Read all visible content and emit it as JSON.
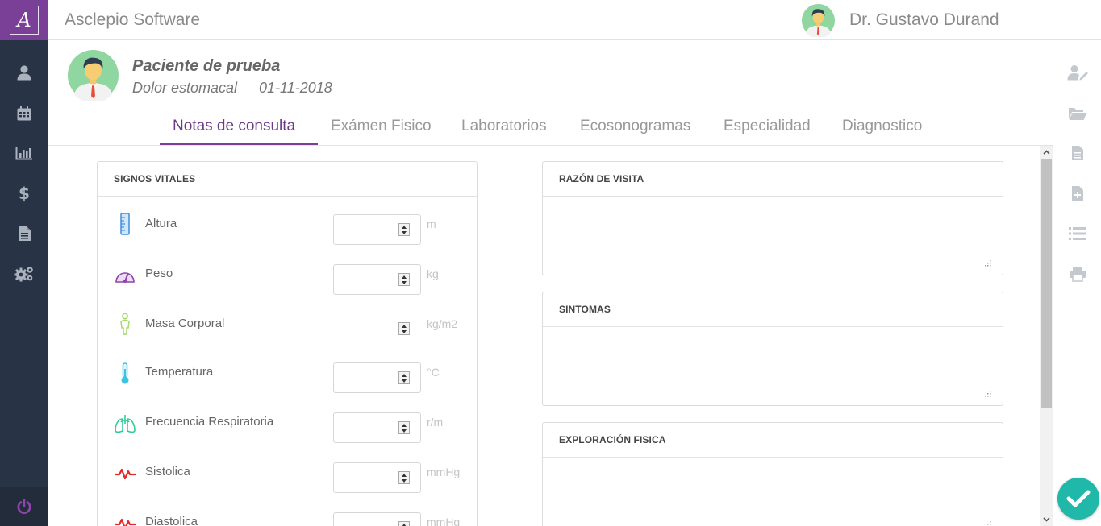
{
  "app": {
    "title": "Asclepio Software",
    "logo_letter": "A"
  },
  "user": {
    "name": "Dr. Gustavo Durand"
  },
  "sidebar": {
    "items": [
      {
        "icon": "user-icon"
      },
      {
        "icon": "calendar-icon"
      },
      {
        "icon": "bar-chart-icon"
      },
      {
        "icon": "dollar-icon"
      },
      {
        "icon": "document-icon"
      },
      {
        "icon": "gears-icon"
      }
    ],
    "footer_icon": "power-icon"
  },
  "patient": {
    "name": "Paciente de prueba",
    "reason": "Dolor estomacal",
    "date": "01-11-2018"
  },
  "tabs": [
    {
      "label": "Notas de consulta",
      "active": true
    },
    {
      "label": "Exámen Fisico"
    },
    {
      "label": "Laboratorios"
    },
    {
      "label": "Ecosonogramas"
    },
    {
      "label": "Especialidad"
    },
    {
      "label": "Diagnostico"
    }
  ],
  "vitals": {
    "title": "SIGNOS VITALES",
    "rows": [
      {
        "label": "Altura",
        "unit": "m",
        "value": ""
      },
      {
        "label": "Peso",
        "unit": "kg",
        "value": ""
      },
      {
        "label": "Masa Corporal",
        "unit": "kg/m2",
        "value": ""
      },
      {
        "label": "Temperatura",
        "unit": "°C",
        "value": ""
      },
      {
        "label": "Frecuencia Respiratoria",
        "unit": "r/m",
        "value": ""
      },
      {
        "label": "Sistolica",
        "unit": "mmHg",
        "value": ""
      },
      {
        "label": "Diastolica",
        "unit": "mmHg",
        "value": ""
      }
    ]
  },
  "notes": {
    "visit_reason": {
      "title": "RAZÓN DE VISITA",
      "value": ""
    },
    "symptoms": {
      "title": "SINTOMAS",
      "value": ""
    },
    "physical_exam": {
      "title": "EXPLORACIÓN FISICA",
      "value": ""
    }
  },
  "right_rail": {
    "icons": [
      "edit-user-icon",
      "folder-open-icon",
      "file-icon",
      "file-add-icon",
      "list-icon",
      "print-icon"
    ]
  },
  "colors": {
    "brand_purple": "#7a3f97",
    "sidebar": "#283445",
    "accent_teal": "#20b8a8"
  }
}
